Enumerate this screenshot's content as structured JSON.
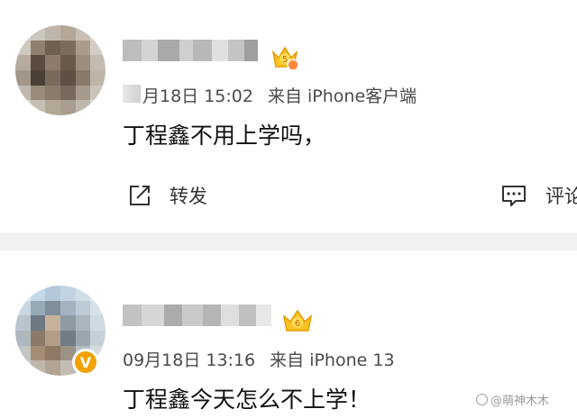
{
  "posts": [
    {
      "timestamp": "月18日 15:02",
      "source": "来自 iPhone客户端",
      "content": "丁程鑫不用上学吗，",
      "vip_level": "5",
      "actions": {
        "repost_label": "转发",
        "comment_label": "评论"
      }
    },
    {
      "timestamp": "09月18日 13:16",
      "source": "来自 iPhone 13",
      "content": "丁程鑫今天怎么不上学！",
      "vip_level": "6",
      "verify_icon": "v-verified-icon"
    }
  ],
  "watermark": "@萌神木木",
  "colors": {
    "vip_gold": "#f2a200",
    "separator": "#f2f2f2",
    "meta_text": "#4a4a4a"
  }
}
